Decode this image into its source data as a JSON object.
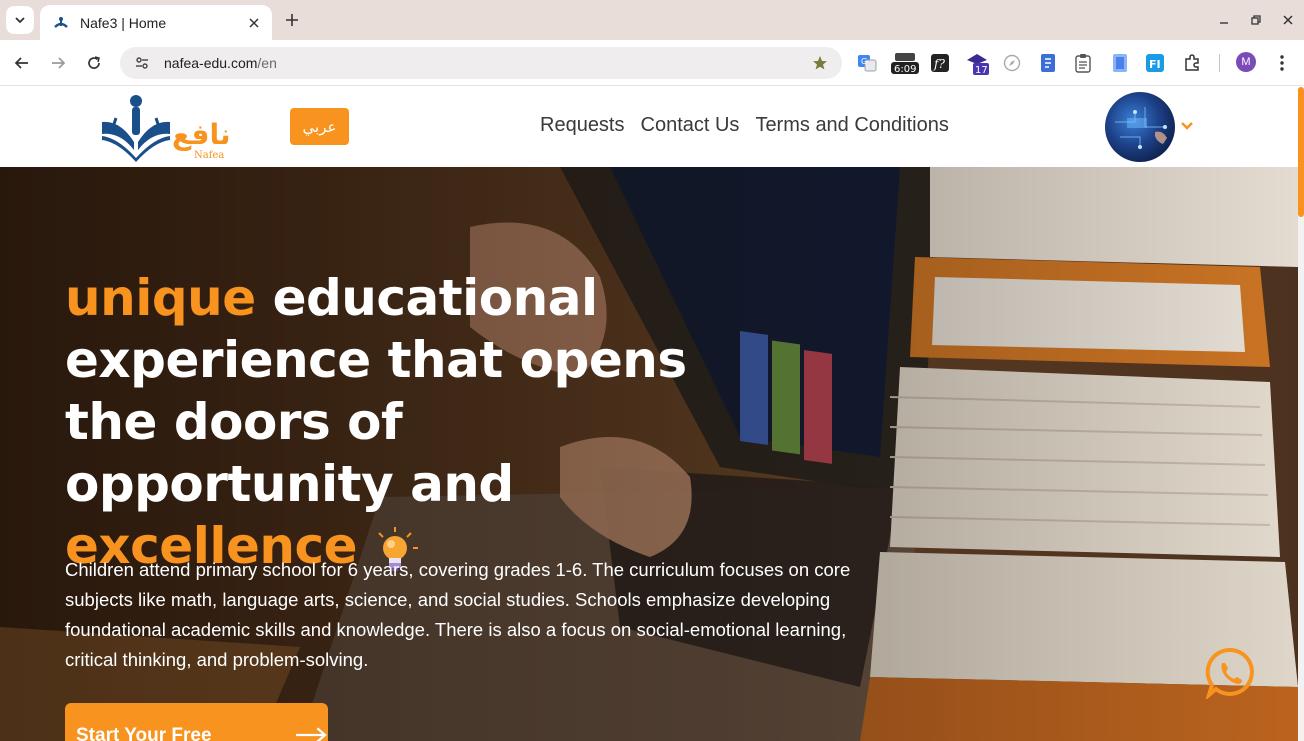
{
  "browser": {
    "tab_title": "Nafe3 | Home",
    "url_host": "nafea-edu.com",
    "url_path": "/en",
    "ext_clock_badge": "6:09",
    "ext_calendar_badge": "17",
    "profile_initial": "M"
  },
  "header": {
    "logo_latin": "Nafea",
    "logo_arabic": "نافع",
    "language_button": "عربي",
    "nav": [
      "Requests",
      "Contact Us",
      "Terms and Conditions"
    ]
  },
  "hero": {
    "title_accent_1": "unique",
    "title_part_1": "educational experience that opens the doors of opportunity and",
    "title_accent_2": "excellence",
    "description": "Children attend primary school for 6 years, covering grades 1-6. The curriculum focuses on core subjects like math, language arts, science, and social studies. Schools emphasize developing foundational academic skills and knowledge. There is also a focus on social-emotional learning, critical thinking, and problem-solving.",
    "cta": "Start Your Free Session"
  },
  "colors": {
    "accent": "#f7931e",
    "logo_blue": "#1b4f8a"
  }
}
